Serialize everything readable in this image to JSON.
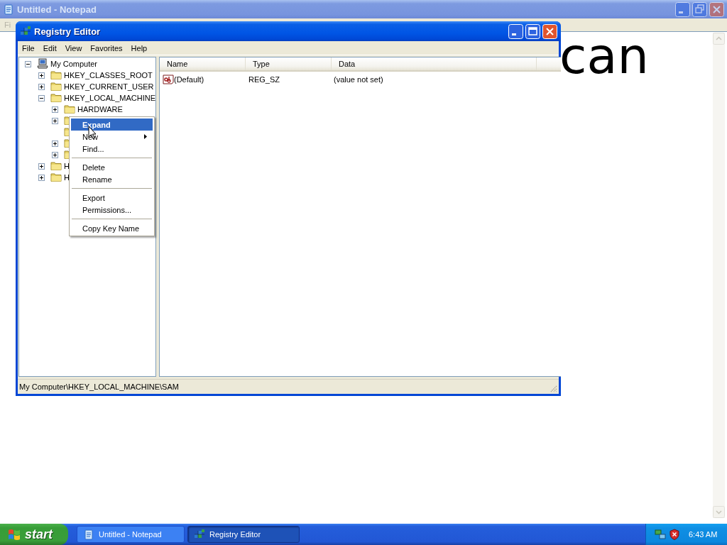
{
  "notepad": {
    "title": "Untitled - Notepad",
    "active": false,
    "menu": [
      "Fi"
    ],
    "text_lines": [
      {
        "end": "can"
      }
    ]
  },
  "registry_editor": {
    "title": "Registry Editor",
    "active": true,
    "menu": [
      "File",
      "Edit",
      "View",
      "Favorites",
      "Help"
    ],
    "tree": {
      "kind": "computer",
      "label": "My Computer",
      "has_children": true,
      "expanded": true,
      "children": [
        {
          "kind": "folder",
          "label": "HKEY_CLASSES_ROOT",
          "has_children": true,
          "expanded": false
        },
        {
          "kind": "folder",
          "label": "HKEY_CURRENT_USER",
          "has_children": true,
          "expanded": false
        },
        {
          "kind": "folder",
          "label": "HKEY_LOCAL_MACHINE",
          "has_children": true,
          "expanded": true,
          "children": [
            {
              "kind": "folder",
              "label": "HARDWARE",
              "has_children": true,
              "expanded": false
            },
            {
              "kind": "folder",
              "has_children": true,
              "expanded": false
            },
            {
              "kind": "folder",
              "has_children": false
            },
            {
              "kind": "folder",
              "has_children": true,
              "expanded": false
            },
            {
              "kind": "folder",
              "has_children": true,
              "expanded": false
            }
          ]
        },
        {
          "kind": "folder",
          "label": "H",
          "has_children": true,
          "expanded": false
        },
        {
          "kind": "folder",
          "label": "H",
          "has_children": true,
          "expanded": false
        }
      ]
    },
    "list": {
      "columns": [
        "Name",
        "Type",
        "Data"
      ],
      "rows": [
        {
          "kind": "string",
          "name": "(Default)",
          "type": "REG_SZ",
          "data": "(value not set)"
        }
      ]
    },
    "status_bar": "My Computer\\HKEY_LOCAL_MACHINE\\SAM"
  },
  "context_menu": {
    "items": [
      {
        "kind": "item",
        "label": "Expand",
        "selected": true,
        "default": true,
        "submenu": false
      },
      {
        "kind": "item",
        "label": "New",
        "selected": false,
        "default": false,
        "submenu": true
      },
      {
        "kind": "item",
        "label": "Find...",
        "selected": false,
        "default": false,
        "submenu": false
      },
      {
        "kind": "separator"
      },
      {
        "kind": "item",
        "label": "Delete",
        "selected": false,
        "default": false,
        "submenu": false
      },
      {
        "kind": "item",
        "label": "Rename",
        "selected": false,
        "default": false,
        "submenu": false
      },
      {
        "kind": "separator"
      },
      {
        "kind": "item",
        "label": "Export",
        "selected": false,
        "default": false,
        "submenu": false
      },
      {
        "kind": "item",
        "label": "Permissions...",
        "selected": false,
        "default": false,
        "submenu": false
      },
      {
        "kind": "separator"
      },
      {
        "kind": "item",
        "label": "Copy Key Name",
        "selected": false,
        "default": false,
        "submenu": false
      }
    ]
  },
  "taskbar": {
    "start": "start",
    "tasks": [
      {
        "kind": "notepad",
        "label": "Untitled - Notepad",
        "selected": false
      },
      {
        "kind": "registry",
        "label": "Registry Editor",
        "selected": true
      }
    ],
    "clock": "6:43 AM"
  }
}
